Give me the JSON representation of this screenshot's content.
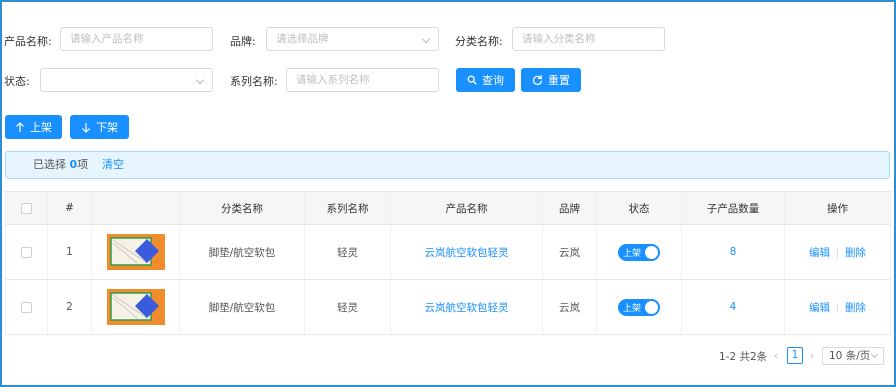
{
  "filters": {
    "product_name_label": "产品名称:",
    "product_name_placeholder": "请输入产品名称",
    "brand_label": "品牌:",
    "brand_placeholder": "请选择品牌",
    "category_label": "分类名称:",
    "category_placeholder": "请输入分类名称",
    "status_label": "状态:",
    "status_value": "",
    "series_label": "系列名称:",
    "series_placeholder": "请输入系列名称",
    "search_label": "查询",
    "reset_label": "重置"
  },
  "actions": {
    "shelve_label": "上架",
    "unshelve_label": "下架"
  },
  "selection": {
    "prefix": "已选择 ",
    "count": "0",
    "suffix": "项",
    "clear_label": "清空"
  },
  "table": {
    "headers": [
      "#",
      "分类名称",
      "系列名称",
      "产品名称",
      "品牌",
      "状态",
      "子产品数量",
      "操作"
    ],
    "rows": [
      {
        "index": "1",
        "category": "脚垫/航空软包",
        "series": "轻灵",
        "product": "云岚航空软包轻灵",
        "brand": "云岚",
        "status": "上架",
        "sub_count": "8",
        "edit": "编辑",
        "delete": "删除"
      },
      {
        "index": "2",
        "category": "脚垫/航空软包",
        "series": "轻灵",
        "product": "云岚航空软包轻灵",
        "brand": "云岚",
        "status": "上架",
        "sub_count": "4",
        "edit": "编辑",
        "delete": "删除"
      }
    ]
  },
  "pagination": {
    "total_text": "1-2 共2条",
    "current_page": "1",
    "page_size": "10 条/页"
  },
  "colors": {
    "primary": "#1890ff",
    "frame_border": "#2f8ecf",
    "thumb_bg": "#f08c2c",
    "thumb_diamond": "#3b5bdb"
  }
}
